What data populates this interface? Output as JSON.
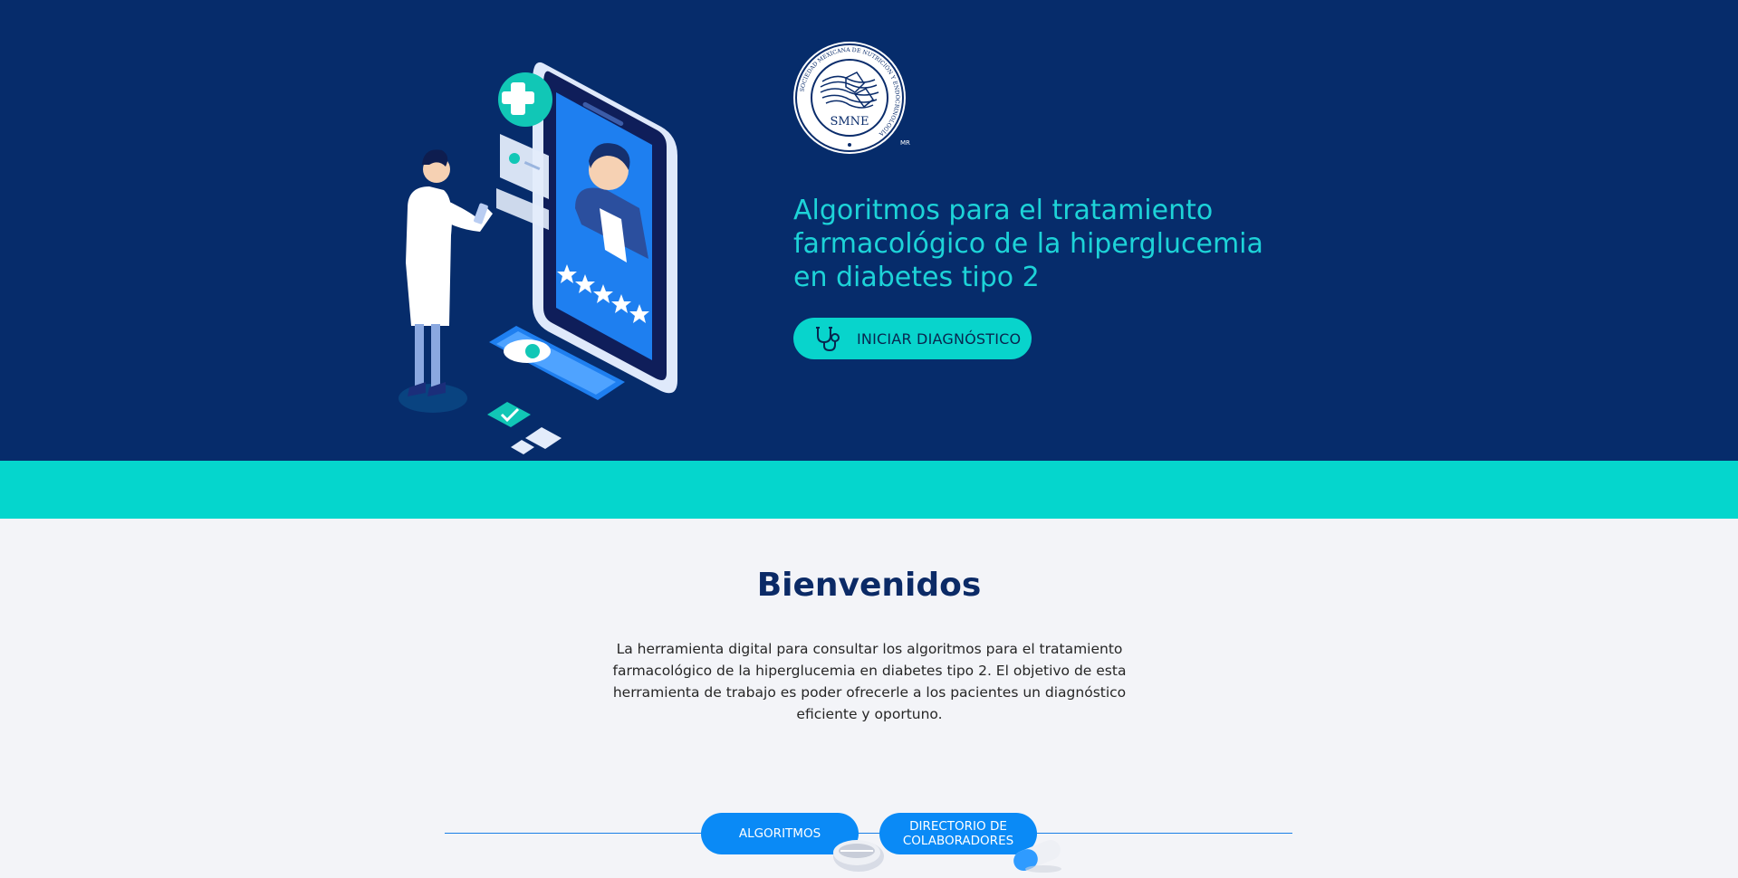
{
  "hero": {
    "logo_text": "SMNE",
    "logo_ring_text": "SOCIEDAD MEXICANA DE NUTRICIÓN Y ENDOCRINOLOGÍA",
    "logo_mark": "MR",
    "title": "Algoritmos para el tratamiento farmacológico de la hiperglucemia en diabetes tipo 2",
    "start_button_label": "INICIAR DIAGNÓSTICO",
    "start_button_icon": "stethoscope-icon",
    "illustration": "doctor-telemedicine-illustration"
  },
  "welcome": {
    "title": "Bienvenidos",
    "text": "La herramienta digital para consultar los algoritmos para el tratamiento farmacológico de la hiperglucemia en diabetes tipo 2. El objetivo de esta herramienta de trabajo es poder ofrecerle a los pacientes un diagnóstico eficiente y oportuno."
  },
  "nav": {
    "algoritmos_label": "ALGORITMOS",
    "directorio_label": "DIRECTORIO DE COLABORADORES"
  },
  "colors": {
    "hero_bg": "#062c6b",
    "accent_teal": "#05d6cd",
    "title_teal": "#1dd3d8",
    "pill_blue": "#0a8af6",
    "heading_navy": "#0b2a66"
  }
}
